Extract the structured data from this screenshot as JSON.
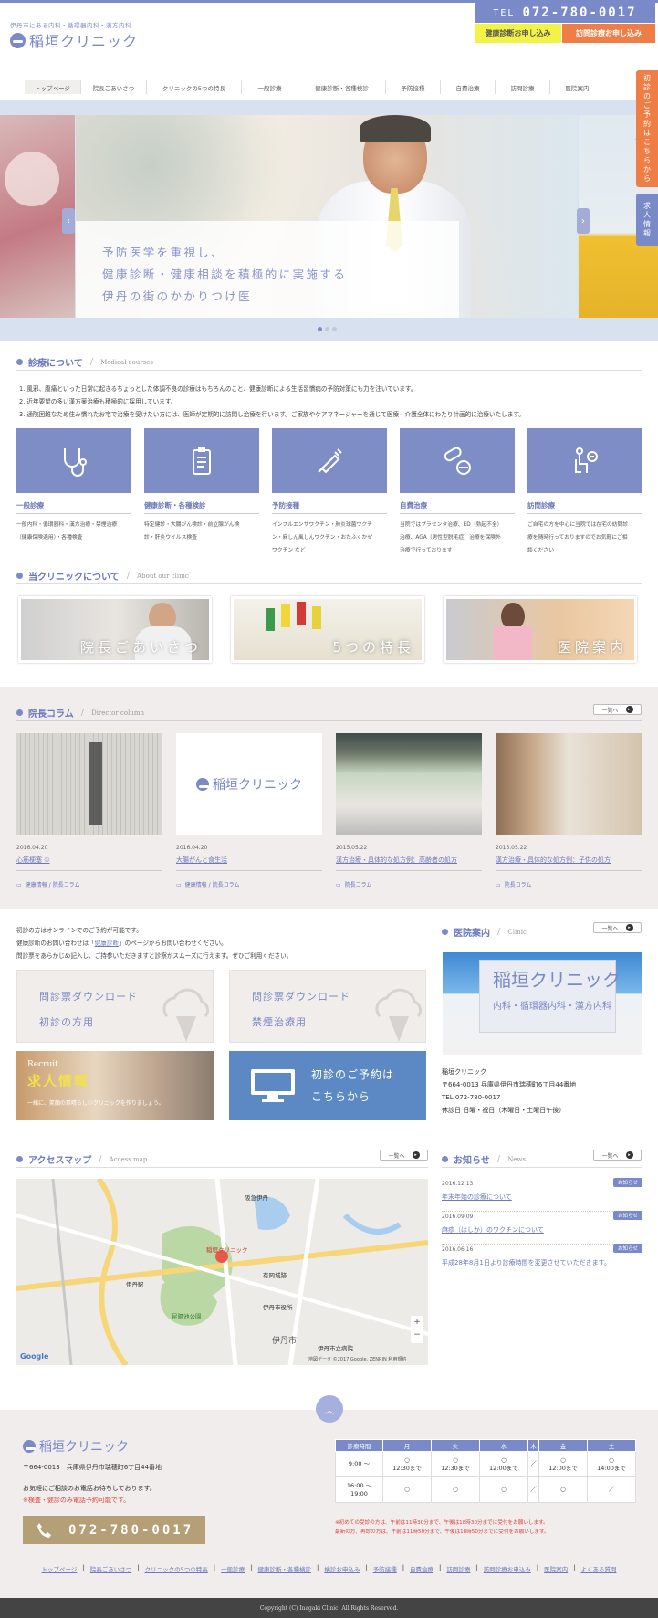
{
  "header": {
    "tagline": "伊丹市にある内科・循環器内科・漢方内科",
    "logo": "稲垣クリニック",
    "tel_label": "TEL",
    "tel": "072-780-0017",
    "btn_apply": "健康診断お申し込み",
    "btn_visit": "訪問診療お申し込み"
  },
  "nav": [
    "トップページ",
    "院長ごあいさつ",
    "クリニックの5つの特長",
    "一般診療",
    "健康診断・各種検診",
    "予防接種",
    "自費治療",
    "訪問診療",
    "医院案内"
  ],
  "side_tabs": {
    "reserve": "初診のご予約はこちらから",
    "recruit": "求人情報"
  },
  "hero": {
    "lines": [
      "予防医学を重視し、",
      "健康診断・健康相談を積極的に実施する",
      "伊丹の街のかかりつけ医"
    ],
    "prev": "‹",
    "next": "›"
  },
  "medical": {
    "title": "診療について",
    "en": "Medical courses",
    "lines": [
      "1. 風邪、腹痛といった日常に起きるちょっとした体調不良の診療はもちろんのこと、健康診断による生活習慣病の予防対策にも力を注いでいます。",
      "2. 近年要望の多い漢方薬治療も積極的に採用しています。",
      "3. 通院困難なため住み慣れたお宅で治療を受けたい方には、医師が定期的に訪問し治療を行います。ご家族やケアマネージャーを通じて医療・介護全体にわたり計画的に治療いたします。"
    ],
    "cards": [
      {
        "icon": "stethoscope-icon",
        "title": "一般診療",
        "desc": [
          "一般内科・循環器科・漢方治療・禁煙治療",
          "（健康保険適用）・各種検査"
        ]
      },
      {
        "icon": "clipboard-icon",
        "title": "健康診断・各種検診",
        "desc": [
          "特定健診・大腸がん検診・前立腺がん検",
          "診・肝炎ウイルス検査"
        ]
      },
      {
        "icon": "syringe-icon",
        "title": "予防接種",
        "desc": [
          "インフルエンザワクチン・肺炎球菌ワクチ",
          "ン・麻しん風しんワクチン・おたふくかぜ",
          "ワクチン など"
        ]
      },
      {
        "icon": "pills-icon",
        "title": "自費治療",
        "desc": [
          "当院ではプラセンタ治療、ED（勃起不全）",
          "治療、AGA（男性型脱毛症）治療を保険外",
          "治療で行っております"
        ]
      },
      {
        "icon": "home-care-icon",
        "title": "訪問診療",
        "desc": [
          "ご自宅の方を中心に当院では在宅の訪問診",
          "療を随時行っておりますのでお気軽にご相",
          "談ください"
        ]
      }
    ]
  },
  "about": {
    "title": "当クリニックについて",
    "en": "About our clinic",
    "cards": [
      "院長ごあいさつ",
      "5つの特長",
      "医院案内"
    ]
  },
  "column": {
    "title": "院長コラム",
    "en": "Director column",
    "more": "一覧へ",
    "items": [
      {
        "date": "2016.04.20",
        "title": "心筋梗塞 ①",
        "tags": [
          "健康情報",
          "院長コラム"
        ]
      },
      {
        "date": "2016.04.20",
        "title": "大腸がんと食生活",
        "tags": [
          "健康情報",
          "院長コラム"
        ]
      },
      {
        "date": "2015.05.22",
        "title": "漢方治療・具体的な処方例：高齢者の処方",
        "tags": [
          "院長コラム"
        ]
      },
      {
        "date": "2015.05.22",
        "title": "漢方治療・具体的な処方例：子供の処方",
        "tags": [
          "院長コラム"
        ]
      }
    ]
  },
  "firstvisit": {
    "lines": [
      "初診の方はオンラインでのご予約が可能です。",
      "健康診断のお問い合わせは「",
      "健康診断",
      "」のページからお問い合わせください。",
      "問診票をあらかじめ記入し、ご持参いただきますと診察がスムーズに行えます。ぜひご利用ください。"
    ],
    "dl1": [
      "問診票ダウンロード",
      "初診の方用"
    ],
    "dl2": [
      "問診票ダウンロード",
      "禁煙治療用"
    ],
    "recruit_en": "Recruit",
    "recruit_jp": "求人情報",
    "recruit_sub": "一緒に、笑顔の素晴らしいクリニックを作りましょう。",
    "reserve": [
      "初診のご予約は",
      "こちらから"
    ]
  },
  "clinic": {
    "title": "医院案内",
    "en": "Clinic",
    "more": "一覧へ",
    "sign": "稲垣クリニック",
    "sign_sub": "内科・循環器内科・漢方内科",
    "name": "稲垣クリニック",
    "addr": "〒664-0013 兵庫県伊丹市瑞穂町6丁目44番地",
    "tel": "TEL 072-780-0017",
    "holiday": "休診日 日曜・祝日（木曜日・土曜日午後）"
  },
  "access": {
    "title": "アクセスマップ",
    "en": "Access map",
    "more": "一覧へ",
    "labels": [
      "伊丹市",
      "伊丹駅",
      "阪急伊丹",
      "伊丹市立病院",
      "昆陽池公園",
      "有岡城跡",
      "稲垣クリニック",
      "伊丹市役所"
    ],
    "google": "Google",
    "credit": "地図データ ©2017 Google, ZENRIN 利用規約"
  },
  "news": {
    "title": "お知らせ",
    "en": "News",
    "more": "一覧へ",
    "badge": "お知らせ",
    "items": [
      {
        "date": "2016.12.13",
        "title": "年末年始の診療について"
      },
      {
        "date": "2016.09.09",
        "title": "麻疹（はしか）のワクチンについて"
      },
      {
        "date": "2016.06.16",
        "title": "平成28年8月1日より診療時間を変更させていただきます。"
      }
    ]
  },
  "footer": {
    "logo": "稲垣クリニック",
    "addr": "〒664-0013　兵庫県伊丹市瑞穂町6丁目44番地",
    "note1": "お気軽にご相談のお電話お待ちしております。",
    "note2": "※検査・健診のみ電話予約可能です。",
    "tel": "072-780-0017",
    "hours_head": [
      "診療時間",
      "月",
      "火",
      "水",
      "木",
      "金",
      "土"
    ],
    "rows": [
      {
        "time": "9:00 〜",
        "cells": [
          "○\n12:30まで",
          "○\n12:30まで",
          "○\n12:00まで",
          "／",
          "○\n12:00まで",
          "○\n14:00まで"
        ]
      },
      {
        "time": "16:00 〜\n19:00",
        "cells": [
          "○",
          "○",
          "○",
          "／",
          "○",
          "／"
        ]
      }
    ],
    "hours_note1": "※初めての受診の方は、午前は11時30分まで、午後は18時30分までに受付をお願いします。",
    "hours_note2": "最新の方、再診の方は、午前は11時50分まで、午後は18時50分までに受付をお願いします。",
    "links": [
      "トップページ",
      "院長ごあいさつ",
      "クリニックの5つの特長",
      "一般診療",
      "健康診断・各種検診",
      "検診お申込み",
      "予防接種",
      "自費治療",
      "訪問診療",
      "訪問診療お申込み",
      "医院案内",
      "よくある質問"
    ],
    "copyright": "Copyright (C) Inagaki Clinic. All Rights Reserved."
  },
  "colors": {
    "accent": "#7a89c7",
    "orange": "#ee7e45",
    "yellow": "#f2f247"
  }
}
